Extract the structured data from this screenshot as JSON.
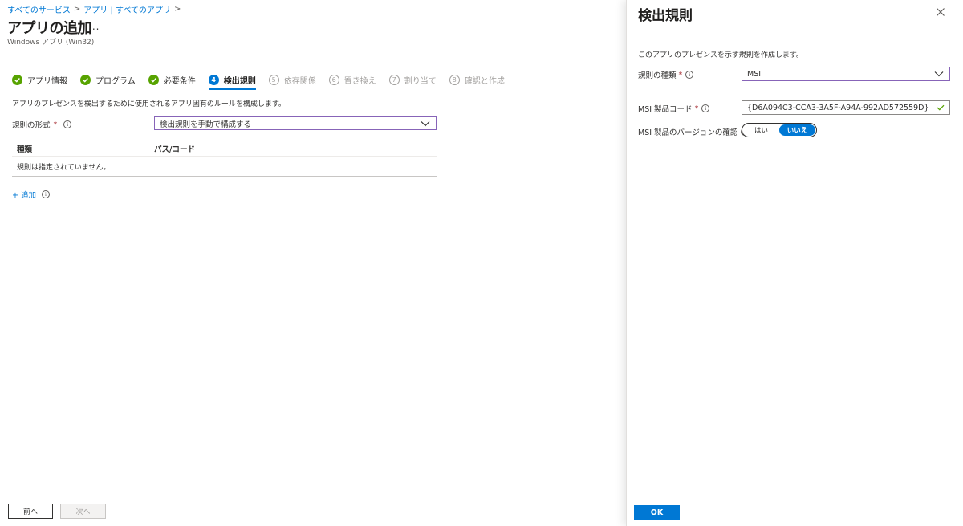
{
  "breadcrumb": {
    "items": [
      "すべてのサービス",
      "アプリ | すべてのアプリ"
    ],
    "separator": ">"
  },
  "header": {
    "title": "アプリの追加",
    "more": "...",
    "subtitle": "Windows アプリ (Win32)"
  },
  "steps": [
    {
      "label": "アプリ情報",
      "state": "done",
      "marker": "✓"
    },
    {
      "label": "プログラム",
      "state": "done",
      "marker": "✓"
    },
    {
      "label": "必要条件",
      "state": "done",
      "marker": "✓"
    },
    {
      "label": "検出規則",
      "state": "current",
      "marker": "4"
    },
    {
      "label": "依存関係",
      "state": "future",
      "marker": "5"
    },
    {
      "label": "置き換え",
      "state": "future",
      "marker": "6"
    },
    {
      "label": "割り当て",
      "state": "future",
      "marker": "7"
    },
    {
      "label": "確認と作成",
      "state": "future",
      "marker": "8"
    }
  ],
  "main": {
    "description": "アプリのプレゼンスを検出するために使用されるアプリ固有のルールを構成します。",
    "rule_format": {
      "label": "規則の形式",
      "required": "*",
      "value": "検出規則を手動で構成する"
    },
    "table": {
      "columns": [
        "種類",
        "パス/コード"
      ],
      "empty_text": "規則は指定されていません。"
    },
    "add_link": {
      "label": "+ 追加"
    }
  },
  "footer": {
    "prev_label": "前へ",
    "next_label": "次へ"
  },
  "panel": {
    "title": "検出規則",
    "description": "このアプリのプレゼンスを示す規則を作成します。",
    "rule_type": {
      "label": "規則の種類",
      "required": "*",
      "value": "MSI"
    },
    "product_code": {
      "label": "MSI 製品コード",
      "required": "*",
      "value": "{D6A094C3-CCA3-3A5F-A94A-992AD572559D}"
    },
    "version_check": {
      "label": "MSI 製品のバージョンの確認",
      "options": [
        "はい",
        "いいえ"
      ],
      "selected": "いいえ"
    },
    "ok_label": "OK"
  },
  "colors": {
    "accent": "#0078d4",
    "success": "#57a300",
    "required": "#a4262c",
    "select_focus": "#8764b8"
  },
  "icons": [
    "chevron-right-icon",
    "more-icon",
    "checkmark-icon",
    "info-icon",
    "chevron-down-icon",
    "close-icon"
  ]
}
